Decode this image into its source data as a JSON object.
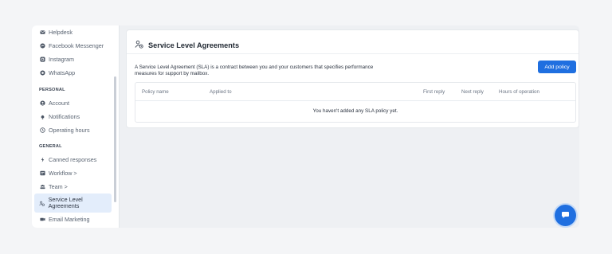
{
  "sidebar": {
    "items_top": [
      {
        "label": "Helpdesk",
        "icon": "mail-icon"
      },
      {
        "label": "Facebook Messenger",
        "icon": "messenger-icon"
      },
      {
        "label": "Instagram",
        "icon": "instagram-icon"
      },
      {
        "label": "WhatsApp",
        "icon": "whatsapp-icon"
      }
    ],
    "section_personal": "PERSONAL",
    "items_personal": [
      {
        "label": "Account",
        "icon": "user-icon"
      },
      {
        "label": "Notifications",
        "icon": "bell-icon"
      },
      {
        "label": "Operating hours",
        "icon": "clock-icon"
      }
    ],
    "section_general": "GENERAL",
    "items_general": [
      {
        "label": "Canned responses",
        "icon": "bolt-icon"
      },
      {
        "label": "Workflow >",
        "icon": "workflow-icon"
      },
      {
        "label": "Team >",
        "icon": "team-icon"
      },
      {
        "label": "Service Level Agreements",
        "icon": "sla-icon"
      },
      {
        "label": "Email Marketing",
        "icon": "email-marketing-icon"
      }
    ]
  },
  "page": {
    "title": "Service Level Agreements",
    "description": "A Service Level Agreement (SLA) is a contract between you and your customers that specifies performance measures for support by mailbox.",
    "add_button": "Add policy"
  },
  "table": {
    "columns": [
      "Policy name",
      "Applied to",
      "First reply",
      "Next reply",
      "Hours of operation"
    ],
    "empty_message": "You haven't added any SLA policy yet."
  },
  "colors": {
    "accent": "#1f6fe0",
    "active_bg": "#e3edfb"
  }
}
